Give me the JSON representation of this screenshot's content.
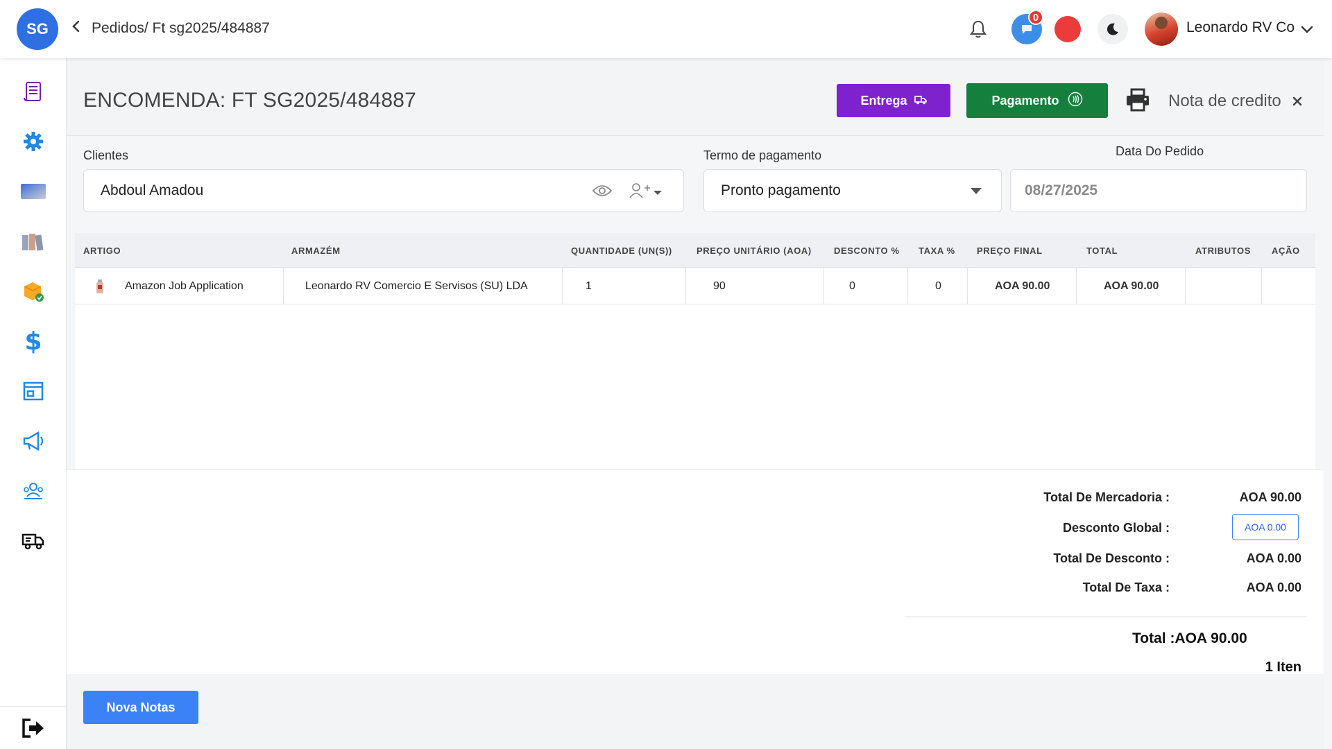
{
  "app": {
    "logo_text": "SG"
  },
  "breadcrumb": {
    "text": "Pedidos/ Ft sg2025/484887"
  },
  "topbar": {
    "chat_badge": "0",
    "user_name": "Leonardo RV Co"
  },
  "sidebar": {
    "items": [
      {
        "icon": "scroll-icon"
      },
      {
        "icon": "gear-icon"
      },
      {
        "icon": "card-icon"
      },
      {
        "icon": "books-icon"
      },
      {
        "icon": "box-check-icon"
      },
      {
        "icon": "dollar-icon"
      },
      {
        "icon": "store-icon"
      },
      {
        "icon": "megaphone-icon"
      },
      {
        "icon": "team-icon"
      },
      {
        "icon": "truck-icon"
      }
    ],
    "logout_icon": "logout-icon"
  },
  "order": {
    "title": "ENCOMENDA: FT SG2025/484887",
    "delivery_label": "Entrega",
    "payment_label": "Pagamento",
    "credit_note_label": "Nota de credito"
  },
  "form": {
    "client_label": "Clientes",
    "client_value": "Abdoul Amadou",
    "term_label": "Termo de pagamento",
    "term_value": "Pronto pagamento",
    "date_label": "Data Do Pedido",
    "date_value": "08/27/2025"
  },
  "table": {
    "headers": [
      "ARTIGO",
      "ARMAZÉM",
      "QUANTIDADE (UN(S))",
      "PREÇO UNITÁRIO (AOA)",
      "DESCONTO %",
      "TAXA %",
      "PREÇO FINAL",
      "TOTAL",
      "ATRIBUTOS",
      "AÇÃO"
    ],
    "rows": [
      {
        "artigo": "Amazon Job Application",
        "armazem": "Leonardo RV Comercio E Servisos (SU) LDA",
        "quantidade": "1",
        "preco_unitario": "90",
        "desconto": "0",
        "taxa": "0",
        "preco_final": "AOA 90.00",
        "total": "AOA 90.00",
        "atributos": "",
        "acao": ""
      }
    ]
  },
  "summary": {
    "merch_label": "Total De Mercadoria :",
    "merch_value": "AOA 90.00",
    "global_disc_label": "Desconto Global :",
    "global_disc_value": "AOA 0.00",
    "disc_total_label": "Total De Desconto :",
    "disc_total_value": "AOA 0.00",
    "tax_total_label": "Total De Taxa :",
    "tax_total_value": "AOA 0.00",
    "grand_total": "Total :AOA 90.00",
    "items_count": "1 Iten"
  },
  "footer": {
    "new_notes_label": "Nova Notas"
  },
  "colors": {
    "primary_blue": "#3b82f6",
    "purple": "#7e22ce",
    "green": "#15803d",
    "sidebar_icon_blue": "#1e88e5"
  }
}
